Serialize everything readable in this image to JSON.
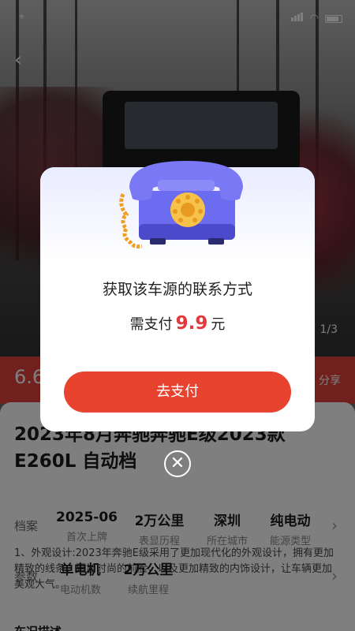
{
  "status_bar": {
    "icons": [
      "location-icon",
      "signal-icon",
      "wifi-icon",
      "battery-icon"
    ]
  },
  "hero": {
    "back_icon": "‹",
    "pager": "1/3"
  },
  "price_strip": {
    "price": "6.6",
    "share_label": "分享"
  },
  "listing": {
    "title": "2023年8月奔驰奔驰E级2023款E260L 自动档",
    "archive_label": "档案",
    "archive_specs": [
      {
        "value": "2025-06",
        "label": "首次上牌"
      },
      {
        "value": "2万公里",
        "label": "表显历程"
      },
      {
        "value": "深圳",
        "label": "所在城市"
      },
      {
        "value": "纯电动",
        "label": "能源类型"
      }
    ],
    "params_label": "参数",
    "params_specs": [
      {
        "value": "单电机",
        "label": "电动机数"
      },
      {
        "value": "2万公里",
        "label": "续航里程"
      }
    ],
    "description": "1、外观设计:2023年奔驰E级采用了更加现代化的外观设计，拥有更加精致的线条，更加时尚的前脸，以及更加精致的内饰设计，让车辆更加美观大气。",
    "bottom_label": "车况描述"
  },
  "modal": {
    "title": "获取该车源的联系方式",
    "price_prefix": "需支付",
    "price_amount": "9.9",
    "price_suffix": "元",
    "pay_button": "去支付",
    "close_icon": "✕"
  },
  "colors": {
    "accent_red": "#e8432f",
    "price_red": "#e4393c",
    "strip_red": "#e2433b"
  }
}
